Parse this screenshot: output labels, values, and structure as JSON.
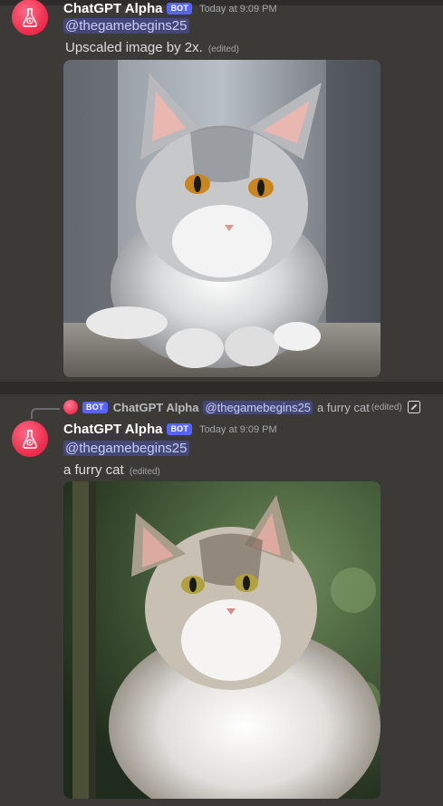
{
  "messages": [
    {
      "username": "ChatGPT Alpha",
      "badge": "BOT",
      "timestamp": "Today at 9:09 PM",
      "mention": "@thegamebegins25",
      "text": "Upscaled image by 2x.",
      "edited": "(edited)",
      "image_alt": "Upscaled fluffy grey and white cat"
    },
    {
      "reply": {
        "badge": "BOT",
        "username": "ChatGPT Alpha",
        "mention": "@thegamebegins25",
        "text": "a furry cat",
        "edited": "(edited)"
      },
      "username": "ChatGPT Alpha",
      "badge": "BOT",
      "timestamp": "Today at 9:09 PM",
      "mention": "@thegamebegins25",
      "text": "a furry cat",
      "edited": "(edited)",
      "image_alt": "Fluffy cat with green foliage background"
    }
  ],
  "colors": {
    "background": "#3b3a37",
    "badge": "#5865f2",
    "avatar": "#f0304f",
    "mention_text": "#c9cdfb"
  },
  "icons": {
    "avatar": "flask-logo-icon",
    "reply_edit": "edit-pencil-icon"
  }
}
